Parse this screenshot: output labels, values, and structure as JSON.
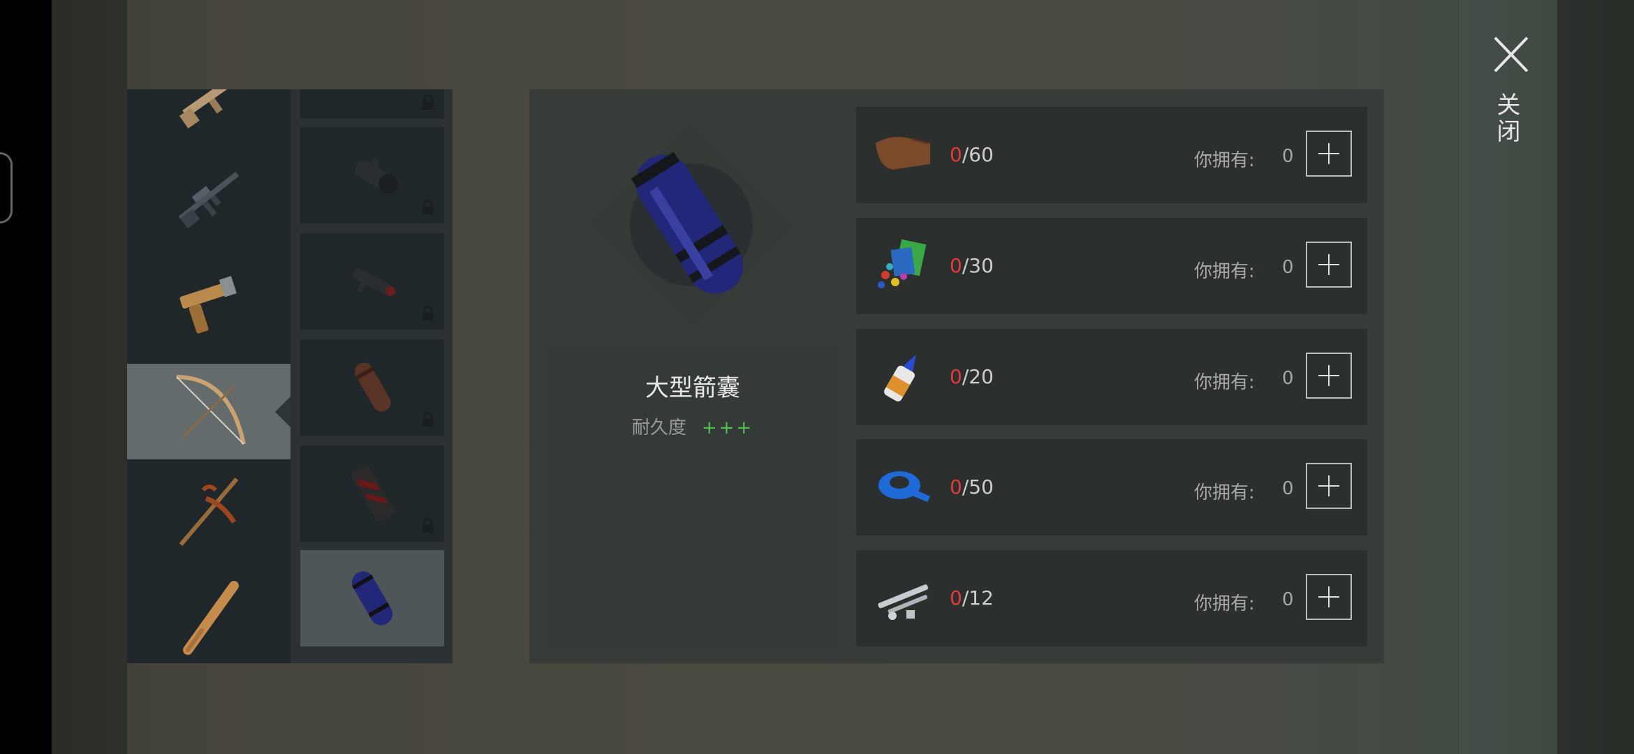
{
  "close": {
    "label": "关闭"
  },
  "categories": [
    {
      "name": "assault-rifle-partial",
      "icon": "rifle-icon",
      "active": false
    },
    {
      "name": "m16-rifle",
      "icon": "assault-rifle-icon",
      "active": false
    },
    {
      "name": "pistol",
      "icon": "pistol-icon",
      "active": false
    },
    {
      "name": "bow",
      "icon": "bow-icon",
      "active": true
    },
    {
      "name": "pickaxe",
      "icon": "pickaxe-icon",
      "active": false
    },
    {
      "name": "baseball-bat",
      "icon": "baseball-bat-icon",
      "active": false
    }
  ],
  "sub_items": [
    {
      "icon": "scope-icon",
      "locked": true,
      "active": false
    },
    {
      "icon": "large-scope-icon",
      "locked": true,
      "active": false
    },
    {
      "icon": "small-scope-icon",
      "locked": true,
      "active": false
    },
    {
      "icon": "leather-quiver-icon",
      "locked": true,
      "active": false
    },
    {
      "icon": "red-quiver-icon",
      "locked": true,
      "active": false
    },
    {
      "icon": "blue-quiver-icon",
      "locked": false,
      "active": true
    }
  ],
  "selected_item": {
    "name": "大型箭囊",
    "durability_label": "耐久度",
    "durability_value": "+++"
  },
  "own_label": "你拥有:",
  "materials": [
    {
      "icon": "leather-icon",
      "have": "0",
      "need": "/60",
      "own": "0"
    },
    {
      "icon": "cloth-scraps-icon",
      "have": "0",
      "need": "/30",
      "own": "0"
    },
    {
      "icon": "glue-icon",
      "have": "0",
      "need": "/20",
      "own": "0"
    },
    {
      "icon": "tape-icon",
      "have": "0",
      "need": "/50",
      "own": "0"
    },
    {
      "icon": "metal-parts-icon",
      "have": "0",
      "need": "/12",
      "own": "0"
    }
  ]
}
